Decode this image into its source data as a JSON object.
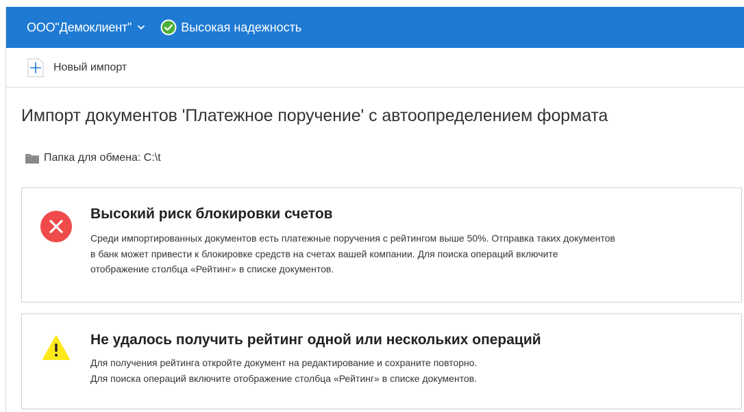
{
  "topbar": {
    "organization": "ООО\"Демоклиент\"",
    "reliability": "Высокая надежность",
    "bg_color": "#1e7ad3",
    "reliability_icon_color": "#4caf3a"
  },
  "toolbar": {
    "new_import_label": "Новый импорт"
  },
  "main": {
    "title": "Импорт документов 'Платежное поручение' с автоопределением формата",
    "folder_label": "Папка для обмена: C:\\t"
  },
  "alerts": {
    "error": {
      "title": "Высокий риск блокировки счетов",
      "lines": [
        "Среди импортированных документов есть платежные поручения с рейтингом выше 50%. Отправка таких документов",
        "в банк может привести к блокировке средств на счетах вашей компании. Для поиска операций включите",
        "отображение столбца «Рейтинг» в списке документов."
      ],
      "icon": "error-circle-icon",
      "color": "#f04b4b"
    },
    "warning": {
      "title": "Не удалось получить рейтинг одной или нескольких операций",
      "lines": [
        "Для получения рейтинга откройте документ на редактирование и сохраните повторно.",
        "Для поиска операций включите отображение столбца «Рейтинг» в списке документов."
      ],
      "icon": "warning-triangle-icon",
      "color": "#ffe81a"
    }
  }
}
